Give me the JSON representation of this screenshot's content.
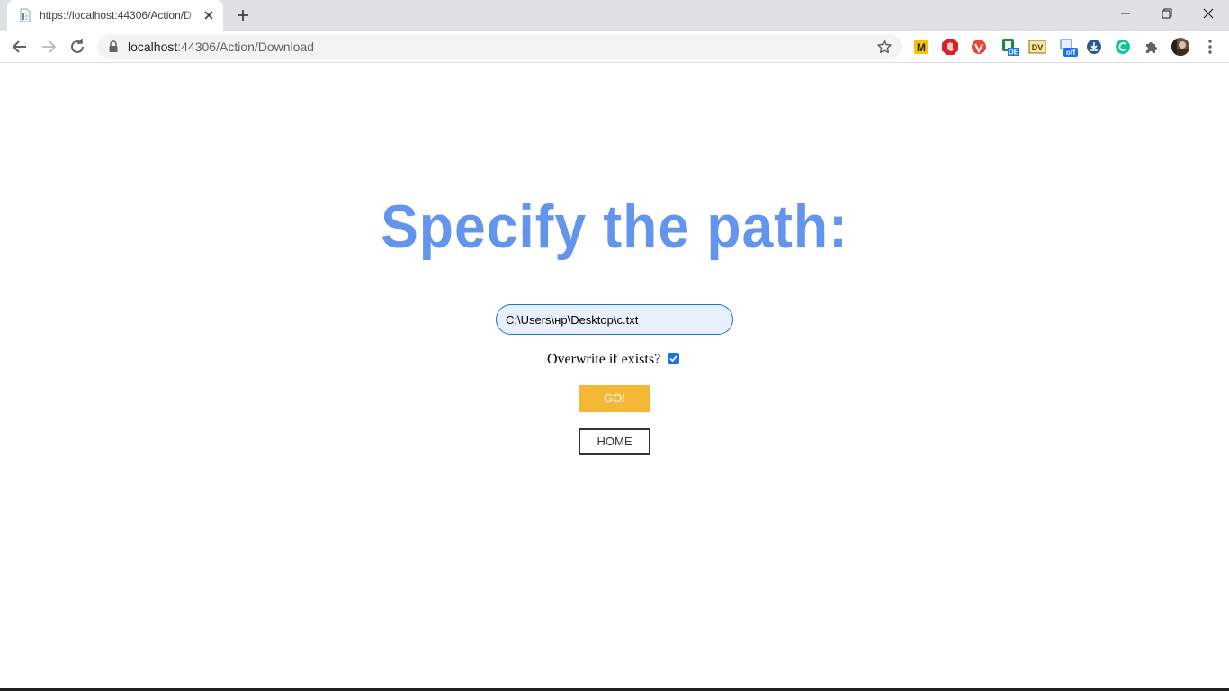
{
  "browser": {
    "tab_title": "https://localhost:44306/Action/D",
    "url_host": "localhost",
    "url_path": ":44306/Action/Download",
    "extensions": [
      "metamask-icon",
      "adblock-icon",
      "vpn-icon",
      "de-icon",
      "dv-icon",
      "off-icon",
      "download-icon",
      "grammarly-icon",
      "puzzle-icon",
      "avatar"
    ],
    "ext_labels": {
      "metamask": "M",
      "de": "DE",
      "dv": "DV",
      "off": "off"
    }
  },
  "page": {
    "heading": "Specify the path:",
    "path_value": "C:\\Users\\нр\\Desktop\\c.txt",
    "overwrite_label": "Overwrite if exists?",
    "overwrite_checked": true,
    "go_label": "GO!",
    "home_label": "HOME"
  },
  "colors": {
    "heading": "#6495ed",
    "go_button": "#f5b836",
    "input_background": "#e8f0fe"
  }
}
